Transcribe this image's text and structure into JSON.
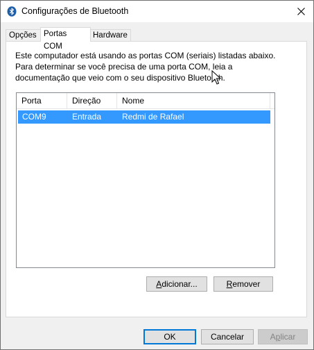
{
  "window": {
    "title": "Configurações de Bluetooth",
    "icon": "bluetooth-icon"
  },
  "tabs": [
    {
      "label": "Opções",
      "active": false
    },
    {
      "label": "Portas COM",
      "active": true
    },
    {
      "label": "Hardware",
      "active": false
    }
  ],
  "description": {
    "line1": "Este computador está usando as portas COM (seriais) listadas abaixo.",
    "line2": "Para determinar se você precisa de uma porta COM, leia a",
    "line3": "documentação que veio com o seu dispositivo Bluetooth."
  },
  "ports_table": {
    "columns": [
      "Porta",
      "Direção",
      "Nome"
    ],
    "rows": [
      {
        "port": "COM9",
        "direction": "Entrada",
        "name": "Redmi de Rafael",
        "selected": true
      }
    ]
  },
  "buttons": {
    "add": {
      "prefix": "",
      "accel": "A",
      "rest": "dicionar..."
    },
    "remove": {
      "prefix": "",
      "accel": "R",
      "rest": "emover"
    },
    "ok": "OK",
    "cancel": "Cancelar",
    "apply": {
      "prefix": "A",
      "accel": "p",
      "rest": "licar"
    }
  },
  "colors": {
    "selection": "#3399ff",
    "accent": "#0078d7"
  }
}
